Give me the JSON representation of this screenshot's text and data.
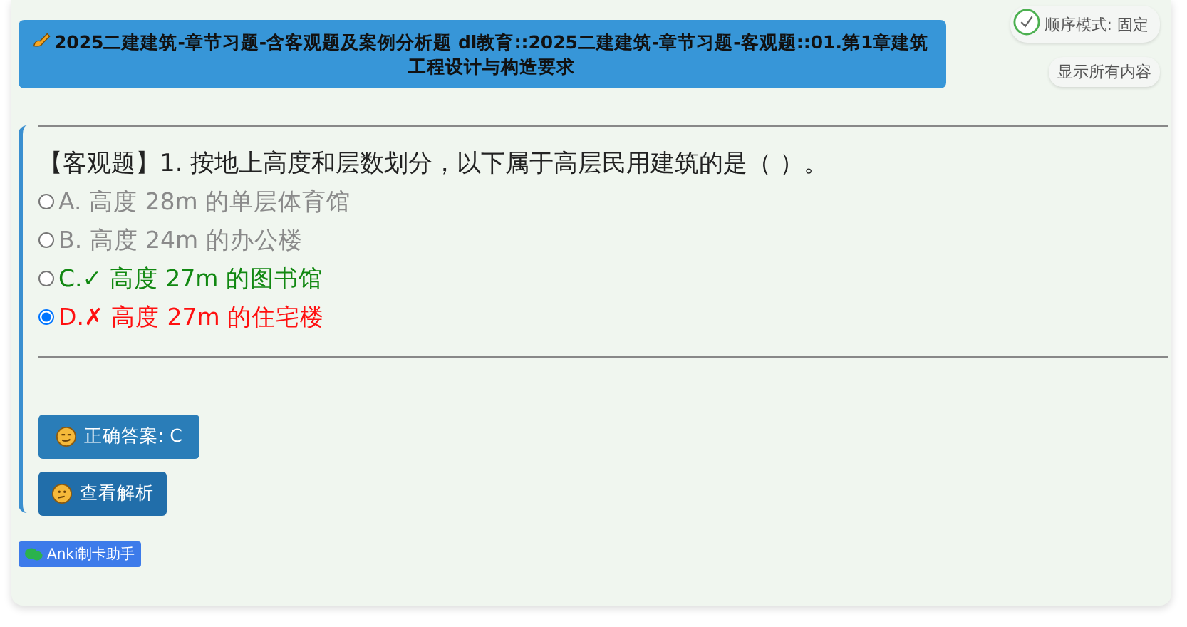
{
  "header": {
    "title": "2025二建建筑-章节习题-含客观题及案例分析题 dl教育::2025二建建筑-章节习题-客观题::01.第1章建筑工程设计与构造要求"
  },
  "order_mode": {
    "label": "顺序模式: 固定",
    "checked": true
  },
  "show_all_button": "显示所有内容",
  "question": {
    "text": "【客观题】1. 按地上高度和层数划分，以下属于高层民用建筑的是（ ）。"
  },
  "options": [
    {
      "text": "A. 高度 28m 的单层体育馆",
      "selected": false,
      "kind": "plain"
    },
    {
      "text": "B. 高度 24m 的办公楼",
      "selected": false,
      "kind": "plain"
    },
    {
      "text": "C.✓ 高度 27m 的图书馆",
      "selected": false,
      "kind": "correct"
    },
    {
      "text": "D.✗ 高度 27m 的住宅楼",
      "selected": true,
      "kind": "wrong"
    }
  ],
  "buttons": [
    {
      "label": "正确答案: C",
      "kind": "answer"
    },
    {
      "label": "查看解析",
      "kind": "analysis"
    }
  ],
  "badge": "Anki制卡助手"
}
